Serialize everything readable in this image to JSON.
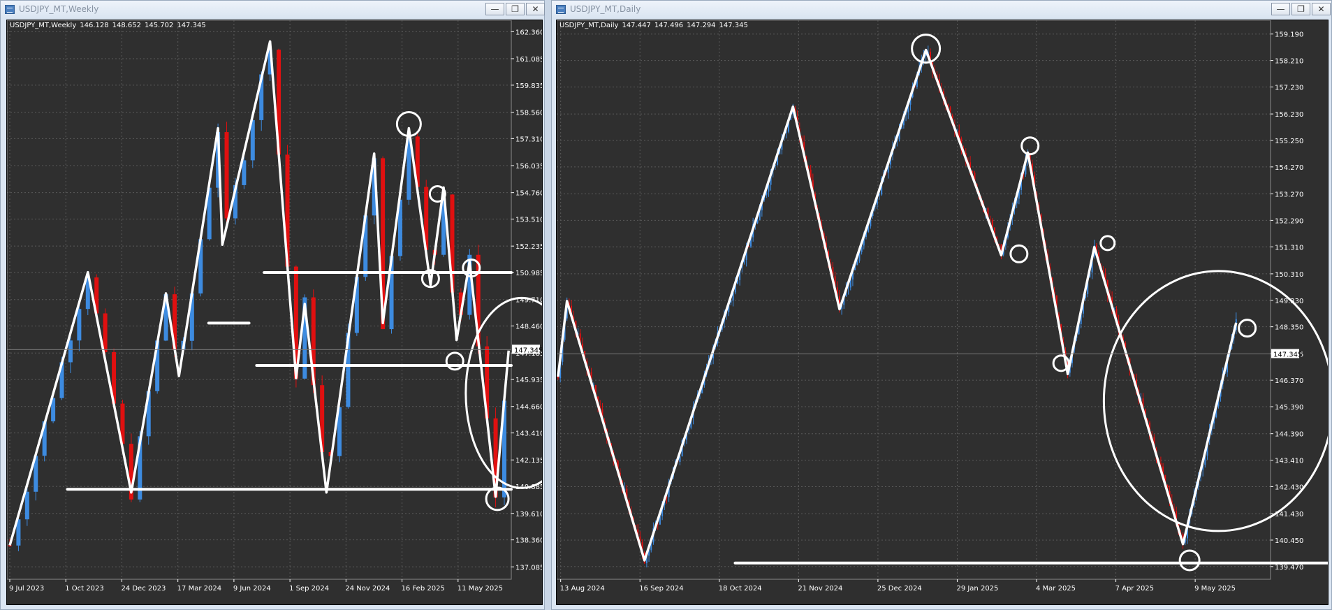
{
  "windows": [
    {
      "title": "USDJPY_MT,Weekly",
      "header": {
        "symbol": "USDJPY_MT,Weekly",
        "open": "146.128",
        "high": "148.652",
        "low": "145.702",
        "close": "147.345"
      },
      "price_label": "147.345",
      "chart_data": {
        "type": "candlestick",
        "title": "USDJPY_MT,Weekly",
        "y_ticks": [
          "162.360",
          "161.085",
          "159.835",
          "158.560",
          "157.310",
          "156.035",
          "154.760",
          "153.510",
          "152.235",
          "150.985",
          "149.710",
          "148.460",
          "147.185",
          "145.935",
          "144.660",
          "143.410",
          "142.135",
          "140.885",
          "139.610",
          "138.360",
          "137.085"
        ],
        "ylim": [
          136.5,
          162.9
        ],
        "x_ticks": [
          "9 Jul 2023",
          "1 Oct 2023",
          "24 Dec 2023",
          "17 Mar 2024",
          "9 Jun 2024",
          "1 Sep 2024",
          "24 Nov 2024",
          "16 Feb 2025",
          "11 May 2025"
        ],
        "last_price": 147.345,
        "bull_color": "#3d8be0",
        "bear_color": "#e01010",
        "zigzag": [
          [
            0,
            138.1
          ],
          [
            9,
            151.0
          ],
          [
            14,
            140.6
          ],
          [
            18,
            150.0
          ],
          [
            19.5,
            146.1
          ],
          [
            24,
            157.8
          ],
          [
            24.5,
            152.3
          ],
          [
            30,
            161.9
          ],
          [
            33,
            146.0
          ],
          [
            34,
            149.5
          ],
          [
            36.5,
            140.6
          ],
          [
            42,
            156.6
          ],
          [
            43,
            148.6
          ],
          [
            46,
            157.8
          ],
          [
            48.5,
            150.4
          ],
          [
            50,
            155.0
          ],
          [
            51.5,
            147.8
          ],
          [
            53,
            151.5
          ],
          [
            56,
            140.4
          ],
          [
            57.5,
            147.3
          ]
        ],
        "horizontal_lines": [
          {
            "price": 140.75,
            "from": 12,
            "to": 100
          },
          {
            "price": 148.6,
            "from": 40,
            "to": 48
          },
          {
            "price": 150.985,
            "from": 51,
            "to": 100
          },
          {
            "price": 146.6,
            "from": 49.5,
            "to": 100
          }
        ],
        "circles": [
          {
            "x": 46,
            "y": 158.0,
            "r": 17
          },
          {
            "x": 49.3,
            "y": 154.7,
            "r": 11
          },
          {
            "x": 48.5,
            "y": 150.7,
            "r": 12
          },
          {
            "x": 53.2,
            "y": 151.2,
            "r": 12
          },
          {
            "x": 51.3,
            "y": 146.8,
            "r": 12
          },
          {
            "x": 56.2,
            "y": 140.3,
            "r": 16
          }
        ],
        "ellipse": {
          "x": 59,
          "y": 145.3,
          "rx": 80,
          "ry": 136
        },
        "bar_count": 58
      }
    },
    {
      "title": "USDJPY_MT,Daily",
      "header": {
        "symbol": "USDJPY_MT,Daily",
        "open": "147.447",
        "high": "147.496",
        "low": "147.294",
        "close": "147.345"
      },
      "price_label": "147.345",
      "chart_data": {
        "type": "candlestick",
        "title": "USDJPY_MT,Daily",
        "y_ticks": [
          "159.190",
          "158.210",
          "157.230",
          "156.230",
          "155.250",
          "154.270",
          "153.270",
          "152.290",
          "151.310",
          "150.310",
          "149.330",
          "148.350",
          "147.345",
          "146.370",
          "145.390",
          "144.390",
          "143.410",
          "142.430",
          "141.430",
          "140.450",
          "139.470"
        ],
        "ylim": [
          139.0,
          159.7
        ],
        "x_ticks": [
          "13 Aug 2024",
          "16 Sep 2024",
          "18 Oct 2024",
          "21 Nov 2024",
          "25 Dec 2024",
          "29 Jan 2025",
          "4 Mar 2025",
          "7 Apr 2025",
          "9 May 2025"
        ],
        "last_price": 147.345,
        "bull_color": "#3d8be0",
        "bear_color": "#e01010",
        "zigzag": [
          [
            0,
            146.5
          ],
          [
            4,
            149.3
          ],
          [
            39,
            139.7
          ],
          [
            106,
            156.5
          ],
          [
            127,
            149.0
          ],
          [
            166,
            158.6
          ],
          [
            200,
            151.0
          ],
          [
            212,
            154.8
          ],
          [
            230,
            146.6
          ],
          [
            242,
            151.3
          ],
          [
            282,
            140.3
          ],
          [
            306,
            148.5
          ]
        ],
        "horizontal_lines": [
          {
            "price": 139.6,
            "from": 25,
            "to": 260
          },
          {
            "price": 148.9,
            "from": 120,
            "to": 225
          },
          {
            "price": 151.35,
            "from": 241,
            "to": 400
          },
          {
            "price": 147.0,
            "from": 224,
            "to": 400
          }
        ],
        "circles": [
          {
            "x": 166,
            "y": 158.65,
            "r": 20
          },
          {
            "x": 213,
            "y": 155.05,
            "r": 12
          },
          {
            "x": 208,
            "y": 151.05,
            "r": 12
          },
          {
            "x": 248,
            "y": 151.45,
            "r": 10
          },
          {
            "x": 227,
            "y": 147.0,
            "r": 11
          },
          {
            "x": 285,
            "y": 139.7,
            "r": 14
          },
          {
            "x": 311,
            "y": 148.3,
            "r": 12
          }
        ],
        "ellipse": {
          "x": 298,
          "y": 145.6,
          "rx": 164,
          "ry": 186
        },
        "bar_count": 320
      }
    }
  ]
}
